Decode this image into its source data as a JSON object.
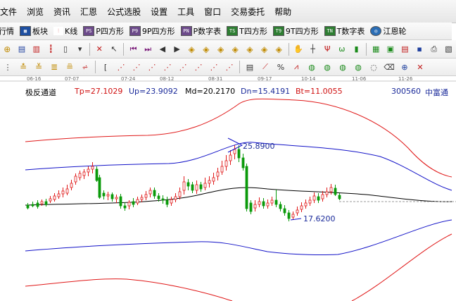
{
  "menu": [
    "文件",
    "浏览",
    "资讯",
    "汇恩",
    "公式选股",
    "设置",
    "工具",
    "窗口",
    "交易委托",
    "帮助"
  ],
  "toolbar_top": [
    {
      "label": "行情",
      "icon": "quote-icon",
      "badge": ""
    },
    {
      "label": "板块",
      "icon": "sector-grid-icon",
      "badge": ""
    },
    {
      "label": "K线",
      "icon": "kline-icon",
      "badge": ""
    },
    {
      "label": "P四方形",
      "icon": "p-square-icon",
      "badge": "PS"
    },
    {
      "label": "9P四方形",
      "icon": "9p-square-icon",
      "badge": "P9"
    },
    {
      "label": "P数字表",
      "icon": "p-number-table-icon",
      "badge": "PN"
    },
    {
      "label": "T四方形",
      "icon": "t-square-icon",
      "badge": "TS"
    },
    {
      "label": "9T四方形",
      "icon": "9t-square-icon",
      "badge": "T9"
    },
    {
      "label": "T数字表",
      "icon": "t-number-table-icon",
      "badge": "TN"
    },
    {
      "label": "江恩轮",
      "icon": "gann-wheel-icon",
      "badge": ""
    }
  ],
  "indicator": {
    "name": "极反通道",
    "tp_label": "Tp=27.1029",
    "up_label": "Up=23.9092",
    "md_label": "Md=20.2170",
    "dn_label": "Dn=15.4191",
    "bt_label": "Bt=11.0055",
    "code": "300560",
    "stock_name": "中富通"
  },
  "dates": [
    "06-16",
    "07-07",
    "07-24",
    "08-12",
    "08-31",
    "09-17",
    "10-14",
    "11-06",
    "11-26"
  ],
  "annotations": {
    "high": "25.8900",
    "low": "17.6200"
  },
  "colors": {
    "up": "#e01818",
    "down": "#0a9a0a",
    "band_outer": "#e01818",
    "band_inner": "#1212c8",
    "mid": "#000000",
    "info_red": "#d01010",
    "info_blue": "#1a2a9a"
  }
}
